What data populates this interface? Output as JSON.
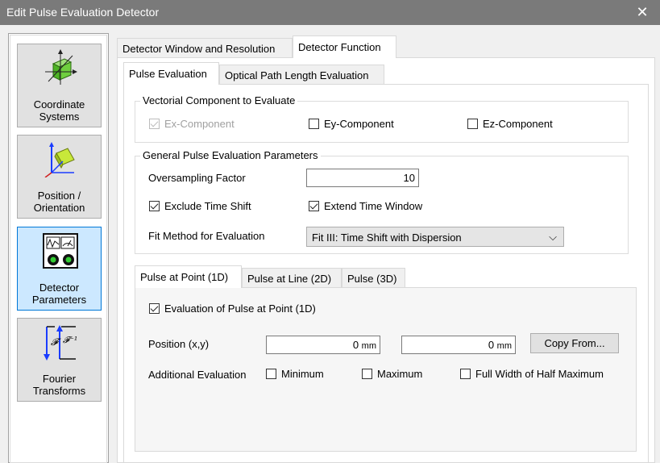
{
  "window": {
    "title": "Edit Pulse Evaluation Detector",
    "close_glyph": "✕"
  },
  "nav": {
    "items": [
      {
        "label": "Coordinate\nSystems",
        "icon": "coordinate-systems-icon"
      },
      {
        "label": "Position /\nOrientation",
        "icon": "position-orientation-icon"
      },
      {
        "label": "Detector\nParameters",
        "icon": "detector-parameters-icon",
        "selected": true
      },
      {
        "label": "Fourier\nTransforms",
        "icon": "fourier-transforms-icon",
        "sym1": "𝓕",
        "sym2": "𝓕⁻¹"
      }
    ]
  },
  "tabs_top": [
    {
      "label": "Detector Window and Resolution"
    },
    {
      "label": "Detector Function",
      "active": true
    }
  ],
  "tabs_sub": [
    {
      "label": "Pulse Evaluation",
      "active": true
    },
    {
      "label": "Optical Path Length Evaluation"
    }
  ],
  "vectorial": {
    "title": "Vectorial Component to Evaluate",
    "ex": {
      "label": "Ex-Component",
      "checked": true,
      "disabled": true
    },
    "ey": {
      "label": "Ey-Component",
      "checked": false
    },
    "ez": {
      "label": "Ez-Component",
      "checked": false
    }
  },
  "general": {
    "title": "General Pulse Evaluation Parameters",
    "oversampling_label": "Oversampling Factor",
    "oversampling_value": "10",
    "exclude_time_shift": {
      "label": "Exclude Time Shift",
      "checked": true
    },
    "extend_time_window": {
      "label": "Extend Time Window",
      "checked": true
    },
    "fit_method_label": "Fit Method for Evaluation",
    "fit_method_value": "Fit III: Time Shift with Dispersion",
    "chevron": "⌵"
  },
  "tabs_pulse": [
    {
      "label": "Pulse at Point (1D)",
      "active": true
    },
    {
      "label": "Pulse at Line (2D)"
    },
    {
      "label": "Pulse (3D)"
    }
  ],
  "point": {
    "eval_checkbox": {
      "label": "Evaluation of Pulse at Point (1D)",
      "checked": true
    },
    "position_label": "Position (x,y)",
    "x_value": "0",
    "y_value": "0",
    "unit": "mm",
    "copy_from": "Copy From...",
    "additional_label": "Additional Evaluation",
    "minimum": {
      "label": "Minimum",
      "checked": false
    },
    "maximum": {
      "label": "Maximum",
      "checked": false
    },
    "fwhm": {
      "label": "Full Width of Half Maximum",
      "checked": false
    }
  },
  "colors": {
    "titlebar": "#7a7a7a",
    "selected_nav_bg": "#cce8ff",
    "selected_nav_border": "#0078d7",
    "coord_icon": "#5ecb2e",
    "pos_icon": "#c8e83a",
    "axis_blue": "#1a3cff"
  }
}
